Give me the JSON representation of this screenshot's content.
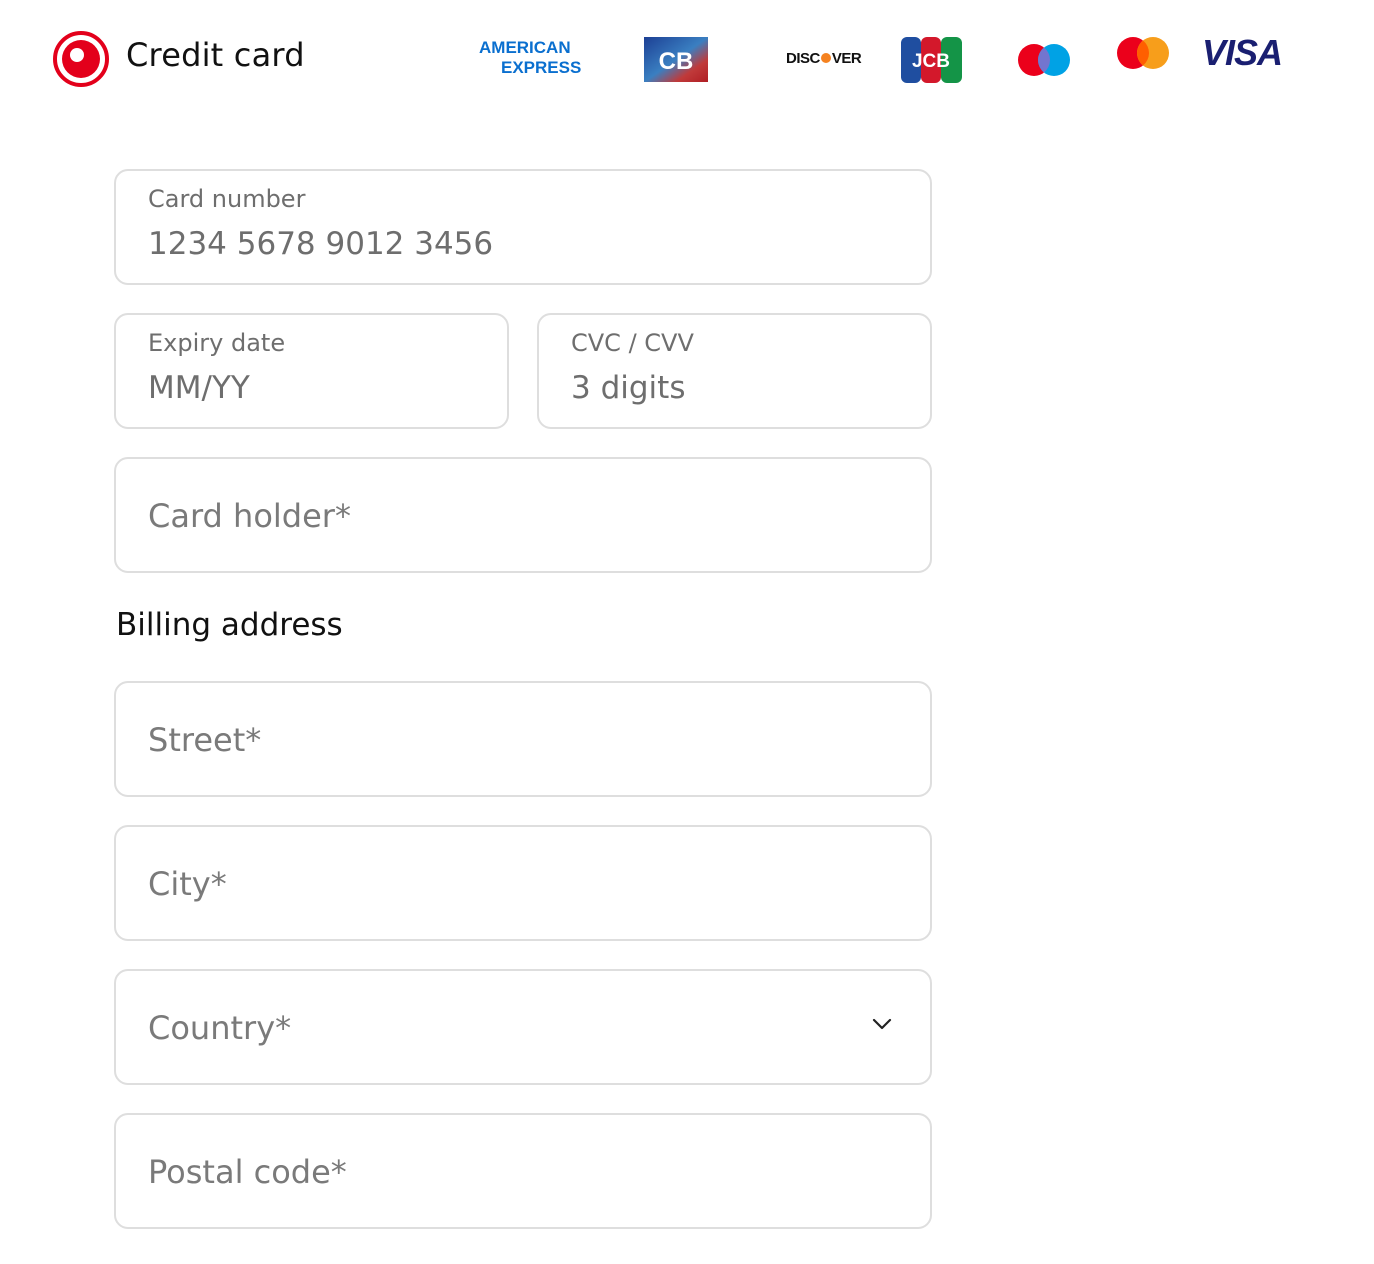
{
  "header": {
    "title": "Credit card",
    "brands": {
      "amex_line1": "AMERICAN",
      "amex_line2": "EXPRESS",
      "cb": "CB",
      "discover_a": "DISC",
      "discover_b": "VER",
      "jcb": "JCB",
      "visa": "VISA"
    }
  },
  "card": {
    "number": {
      "label": "Card number",
      "placeholder": "1234 5678 9012 3456"
    },
    "expiry": {
      "label": "Expiry date",
      "placeholder": "MM/YY"
    },
    "cvc": {
      "label": "CVC / CVV",
      "placeholder": "3 digits"
    },
    "holder": {
      "placeholder": "Card holder*"
    }
  },
  "billing": {
    "title": "Billing address",
    "street": {
      "placeholder": "Street*"
    },
    "city": {
      "placeholder": "City*"
    },
    "country": {
      "placeholder": "Country*"
    },
    "postal": {
      "placeholder": "Postal code*"
    }
  },
  "colors": {
    "accent": "#e3001b",
    "border": "#dedede",
    "muted_text": "#6e6e6e"
  }
}
